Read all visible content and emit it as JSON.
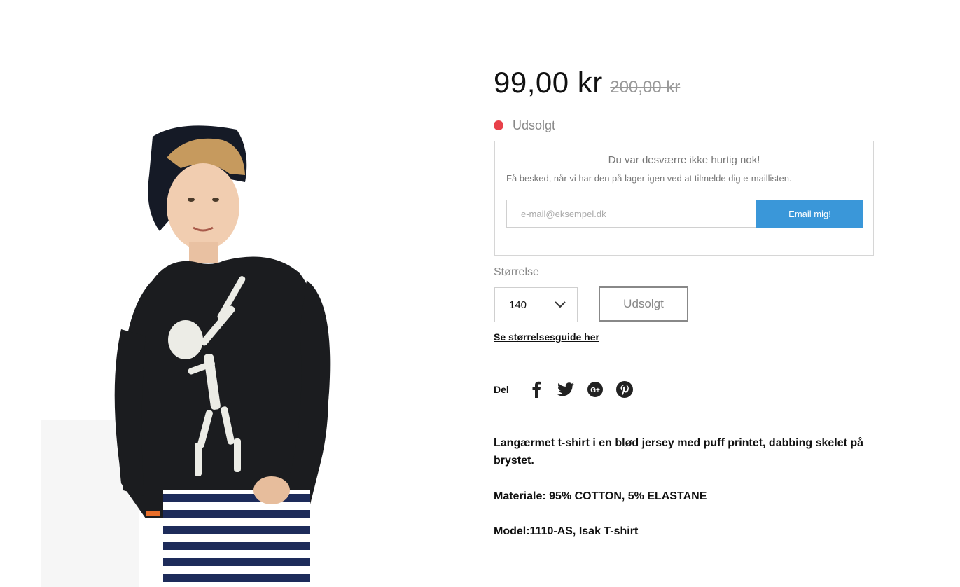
{
  "product": {
    "price": "99,00 kr",
    "old_price": "200,00 kr",
    "stock_status": "Udsolgt",
    "stock_color": "#e8414a"
  },
  "notify": {
    "title": "Du var desværre ikke hurtig nok!",
    "subtitle": "Få besked, når vi har den på lager igen ved at tilmelde dig e-maillisten.",
    "email_placeholder": "e-mail@eksempel.dk",
    "email_value": "",
    "button_label": "Email mig!",
    "button_color": "#3a97d9"
  },
  "size": {
    "label": "Størrelse",
    "selected": "140",
    "soldout_label": "Udsolgt",
    "guide_link": "Se størrelsesguide her"
  },
  "share": {
    "label": "Del",
    "icons": [
      "facebook-icon",
      "twitter-icon",
      "google-plus-icon",
      "pinterest-icon"
    ]
  },
  "description": {
    "text": "Langærmet t-shirt i en blød jersey med puff printet, dabbing skelet på brystet.",
    "material": "Materiale: 95% COTTON, 5% ELASTANE",
    "model": "Model:1110-AS, Isak T-shirt"
  }
}
